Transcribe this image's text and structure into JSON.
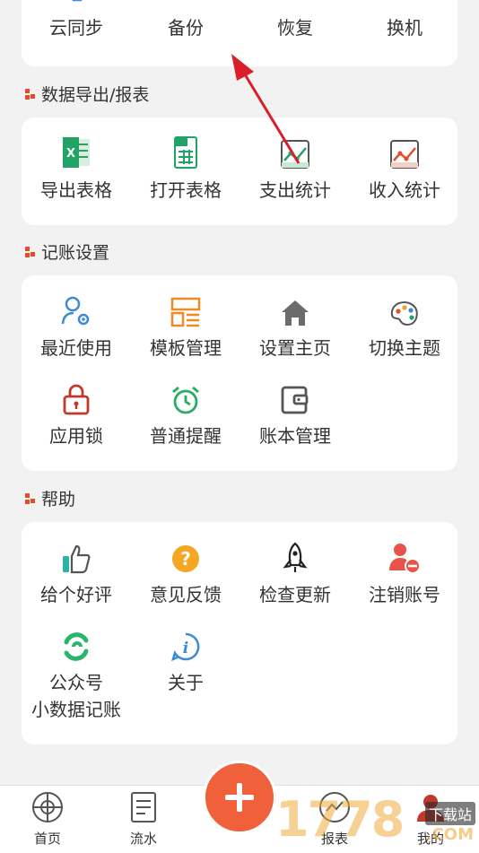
{
  "sync_section": {
    "items": [
      {
        "label": "云同步",
        "icon": "cloud-sync-icon"
      },
      {
        "label": "备份",
        "icon": "backup-icon"
      },
      {
        "label": "恢复",
        "icon": "restore-icon"
      },
      {
        "label": "换机",
        "icon": "switch-device-icon"
      }
    ]
  },
  "export_section": {
    "title": "数据导出/报表",
    "items": [
      {
        "label": "导出表格",
        "icon": "excel-icon"
      },
      {
        "label": "打开表格",
        "icon": "spreadsheet-icon"
      },
      {
        "label": "支出统计",
        "icon": "expense-chart-icon"
      },
      {
        "label": "收入统计",
        "icon": "income-chart-icon"
      }
    ]
  },
  "settings_section": {
    "title": "记账设置",
    "items": [
      {
        "label": "最近使用",
        "icon": "user-gear-icon"
      },
      {
        "label": "模板管理",
        "icon": "template-icon"
      },
      {
        "label": "设置主页",
        "icon": "home-icon"
      },
      {
        "label": "切换主题",
        "icon": "palette-icon"
      },
      {
        "label": "应用锁",
        "icon": "lock-icon"
      },
      {
        "label": "普通提醒",
        "icon": "alarm-icon"
      },
      {
        "label": "账本管理",
        "icon": "wallet-icon"
      }
    ]
  },
  "help_section": {
    "title": "帮助",
    "items": [
      {
        "label": "给个好评",
        "icon": "thumbs-up-icon"
      },
      {
        "label": "意见反馈",
        "icon": "question-icon"
      },
      {
        "label": "检查更新",
        "icon": "rocket-icon"
      },
      {
        "label": "注销账号",
        "icon": "user-remove-icon"
      },
      {
        "label": "公众号",
        "label2": "小数据记账",
        "icon": "wechat-icon"
      },
      {
        "label": "关于",
        "icon": "info-icon"
      }
    ]
  },
  "tabbar": {
    "tabs": [
      {
        "label": "首页",
        "icon": "home-tab-icon"
      },
      {
        "label": "流水",
        "icon": "document-tab-icon"
      },
      {
        "label": "报表",
        "icon": "report-tab-icon"
      },
      {
        "label": "我的",
        "icon": "profile-tab-icon"
      }
    ],
    "fab_icon": "plus-icon"
  },
  "watermark": {
    "text": "1778",
    "badge": "下载站",
    "suffix": ".COM"
  },
  "colors": {
    "accent": "#f0603a",
    "section_mark": "#e34c26",
    "annotation_arrow": "#d9202a"
  }
}
